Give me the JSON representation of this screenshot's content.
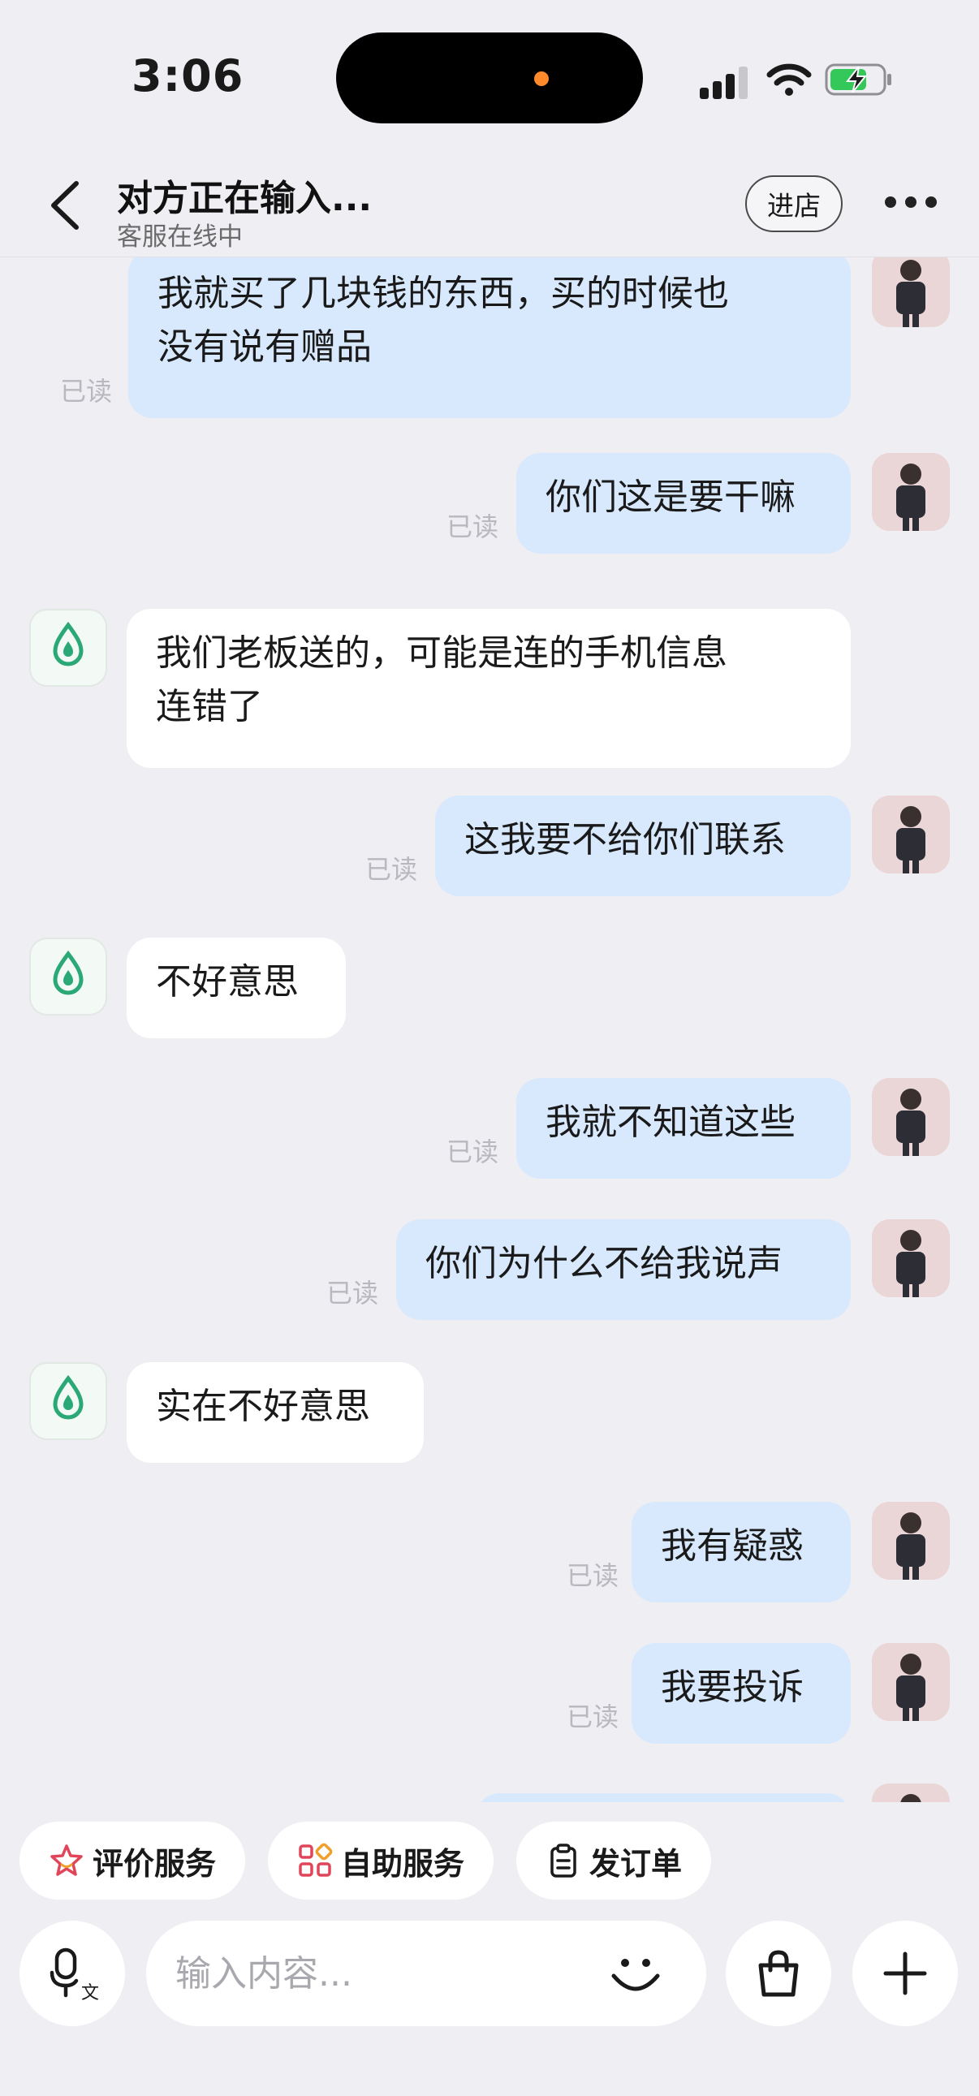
{
  "status_bar": {
    "time": "3:06"
  },
  "nav": {
    "title": "对方正在输入...",
    "subtitle": "客服在线中",
    "enter_store_label": "进店"
  },
  "messages": [
    {
      "from": "user",
      "lines": [
        "我就买了几块钱的东西，买的时候也",
        "没有说有赠品"
      ],
      "status": "已读"
    },
    {
      "from": "user",
      "lines": [
        "你们这是要干嘛"
      ],
      "status": "已读"
    },
    {
      "from": "service",
      "lines": [
        "我们老板送的，可能是连的手机信息",
        "连错了"
      ]
    },
    {
      "from": "user",
      "lines": [
        "这我要不给你们联系"
      ],
      "status": "已读"
    },
    {
      "from": "service",
      "lines": [
        "不好意思"
      ]
    },
    {
      "from": "user",
      "lines": [
        "我就不知道这些"
      ],
      "status": "已读"
    },
    {
      "from": "user",
      "lines": [
        "你们为什么不给我说声"
      ],
      "status": "已读"
    },
    {
      "from": "service",
      "lines": [
        "实在不好意思"
      ]
    },
    {
      "from": "user",
      "lines": [
        "我有疑惑"
      ],
      "status": "已读"
    },
    {
      "from": "user",
      "lines": [
        "我要投诉"
      ],
      "status": "已读"
    }
  ],
  "quick_actions": [
    {
      "label": "评价服务",
      "icon": "star-badge-icon"
    },
    {
      "label": "自助服务",
      "icon": "grid-apps-icon"
    },
    {
      "label": "发订单",
      "icon": "clipboard-icon"
    }
  ],
  "input": {
    "placeholder": "输入内容...",
    "voice_icon": "voice-translate-icon",
    "emoji_icon": "smile-icon",
    "shop_icon": "shopping-bag-icon",
    "plus_icon": "plus-icon"
  },
  "colors": {
    "background": "#eeeef3",
    "my_bubble": "#d8e9fd",
    "their_bubble": "#ffffff",
    "service_green": "#2aa876",
    "quick_icon_red": "#e0455a"
  }
}
